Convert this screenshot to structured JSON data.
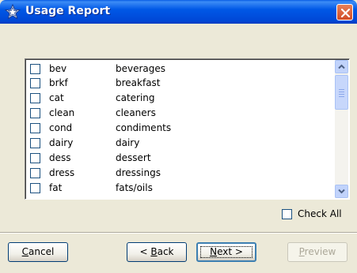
{
  "window": {
    "title": "Usage Report",
    "titlebar_color": "#0054e3",
    "close_color": "#d24c26"
  },
  "list": {
    "items": [
      {
        "code": "bev",
        "description": "beverages",
        "checked": false
      },
      {
        "code": "brkf",
        "description": "breakfast",
        "checked": false
      },
      {
        "code": "cat",
        "description": "catering",
        "checked": false
      },
      {
        "code": "clean",
        "description": "cleaners",
        "checked": false
      },
      {
        "code": "cond",
        "description": "condiments",
        "checked": false
      },
      {
        "code": "dairy",
        "description": "dairy",
        "checked": false
      },
      {
        "code": "dess",
        "description": "dessert",
        "checked": false
      },
      {
        "code": "dress",
        "description": "dressings",
        "checked": false
      },
      {
        "code": "fat",
        "description": "fats/oils",
        "checked": false
      }
    ]
  },
  "check_all": {
    "label": "Check All",
    "checked": false
  },
  "buttons": {
    "cancel": {
      "mnemonic": "C",
      "rest": "ancel"
    },
    "back": {
      "prefix": "< ",
      "mnemonic": "B",
      "rest": "ack"
    },
    "next": {
      "mnemonic": "N",
      "rest": "ext >"
    },
    "preview": {
      "mnemonic": "P",
      "rest": "review",
      "enabled": false
    }
  }
}
